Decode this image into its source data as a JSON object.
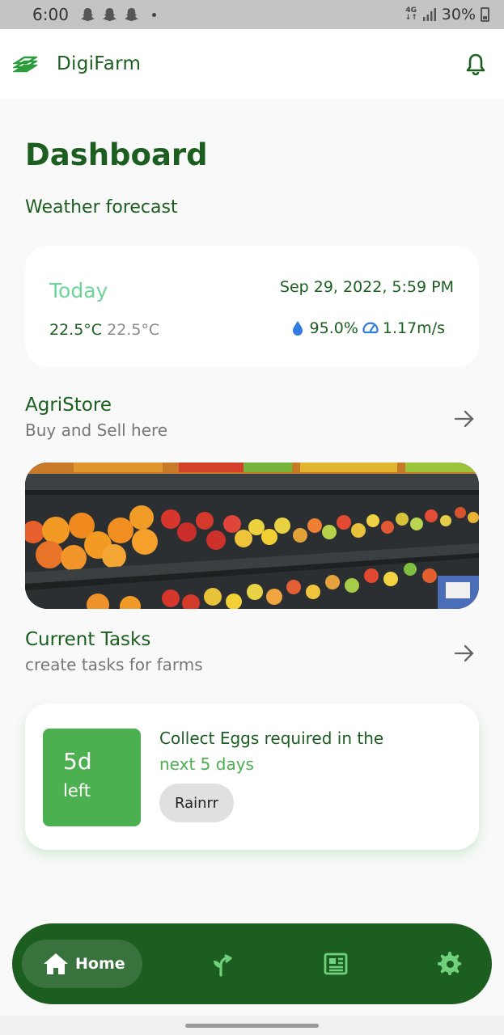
{
  "status_bar": {
    "time": "6:00",
    "network": "4G",
    "battery": "30%"
  },
  "app": {
    "name": "DigiFarm",
    "logo_icon": "leaf-logo-icon",
    "notification_icon": "bell-icon"
  },
  "page": {
    "title": "Dashboard"
  },
  "weather": {
    "section_title": "Weather forecast",
    "day_label": "Today",
    "temp_max": "22.5°C",
    "temp_min": "22.5°C",
    "datetime": "Sep 29, 2022, 5:59 PM",
    "humidity": "95.0%",
    "wind_speed": "1.17m/s"
  },
  "agristore": {
    "title": "AgriStore",
    "subtitle": "Buy and Sell here"
  },
  "tasks": {
    "title": "Current Tasks",
    "subtitle": "create tasks for farms",
    "items": [
      {
        "days": "5d",
        "days_suffix": "left",
        "text_main": "Collect Eggs required in the",
        "text_accent": "next 5 days",
        "tag": "Rainrr"
      }
    ]
  },
  "bottom_nav": {
    "items": [
      {
        "label": "Home",
        "icon": "home-icon",
        "active": true
      },
      {
        "label": "",
        "icon": "plant-icon",
        "active": false
      },
      {
        "label": "",
        "icon": "newspaper-icon",
        "active": false
      },
      {
        "label": "",
        "icon": "settings-icon",
        "active": false
      }
    ]
  },
  "colors": {
    "primary": "#1b5e20",
    "accent": "#4caf50",
    "today": "#6dd49a",
    "background": "#f8f9f8"
  }
}
